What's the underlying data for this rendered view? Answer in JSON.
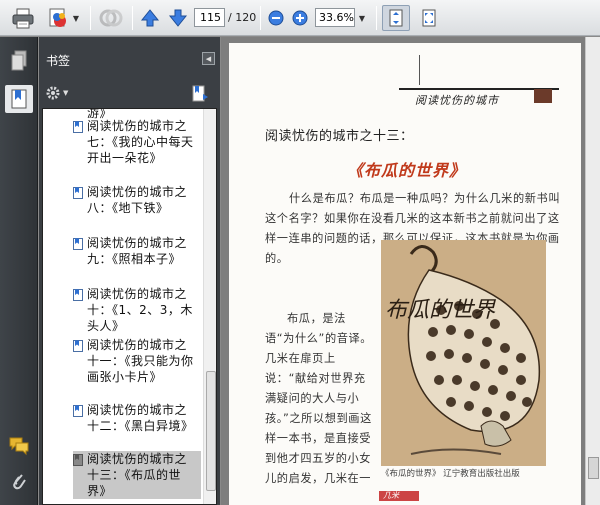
{
  "toolbar": {
    "icons": [
      "print-icon",
      "create-pdf-icon",
      "share-icon",
      "prev-page-icon",
      "next-page-icon",
      "zoom-out-icon",
      "zoom-in-icon",
      "fit-page-icon",
      "full-screen-icon"
    ],
    "page_current": "115",
    "page_total": "/ 120",
    "zoom": "33.6%"
  },
  "panel": {
    "title": "书签",
    "items": [
      {
        "text": "阅读忧伤的城市之七：《我的心中每天开出一朵花》"
      },
      {
        "text": "阅读忧伤的城市之八：《地下铁》"
      },
      {
        "text": "阅读忧伤的城市之九：《照相本子》"
      },
      {
        "text": "阅读忧伤的城市之十：《1、2、3，木头人》"
      },
      {
        "text": "阅读忧伤的城市之十一：《我只能为你画张小卡片》"
      },
      {
        "text": "阅读忧伤的城市之十二：《黑白异境》"
      },
      {
        "text": "阅读忧伤的城市之十三：《布瓜的世界》"
      }
    ],
    "partial_top": "游》"
  },
  "document": {
    "header": "阅读忧伤的城市",
    "chapter": "阅读忧伤的城市之十三：",
    "title": "《布瓜的世界》",
    "para1": "什么是布瓜？布瓜是一种瓜吗？为什么几米的新书叫这个名字？如果你在没看几米的这本新书之前就问出了这样一连串的问题的话，那么可以保证，这本书就是为你画的。",
    "para2": "布瓜，是法语“为什么”的音译。几米在扉页上说：“献给对世界充满疑问的大人与小孩。”之所以想到画这样一本书，是直接受到他才四五岁的小女儿的启发，几米在一次访谈中直接承认，女儿是他的灵感源",
    "caption": "《布瓜的世界》 辽宁教育出版社出版",
    "footer": "几米",
    "illustration_title": "布瓜的世界"
  },
  "colors": {
    "title_red": "#c0391b",
    "panel_dark": "#3a3e42"
  }
}
